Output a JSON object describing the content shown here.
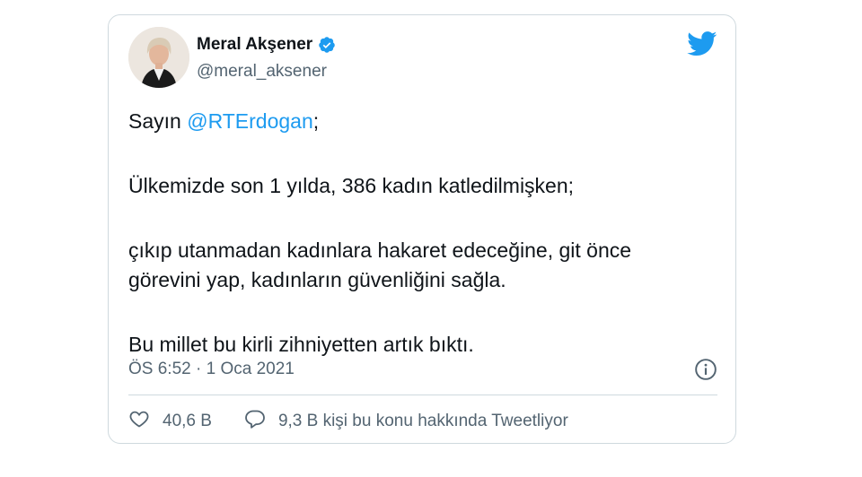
{
  "tweet": {
    "author": {
      "display_name": "Meral Akşener",
      "handle": "@meral_aksener",
      "verified": true
    },
    "text": {
      "greeting_prefix": "Sayın ",
      "mention": "@RTErdogan",
      "greeting_suffix": ";",
      "paragraph_2": "Ülkemizde son 1 yılda, 386 kadın katledilmişken;",
      "paragraph_3_line_1": "çıkıp utanmadan kadınlara hakaret edeceğine, git önce",
      "paragraph_3_line_2": "görevini yap, kadınların güvenliğini sağla.",
      "paragraph_4": "Bu millet bu kirli zihniyetten artık bıktı."
    },
    "timestamp": "ÖS 6:52 · 1 Oca 2021",
    "likes": "40,6 B",
    "replies_text": "9,3 B kişi bu konu hakkında Tweetliyor"
  },
  "colors": {
    "brand_blue": "#1d9bf0",
    "text": "#0f1419",
    "secondary_text": "#536471",
    "border": "#cfd9de"
  },
  "icons": [
    "twitter-bird-icon",
    "verified-badge-icon",
    "info-icon",
    "heart-icon",
    "reply-bubble-icon"
  ]
}
